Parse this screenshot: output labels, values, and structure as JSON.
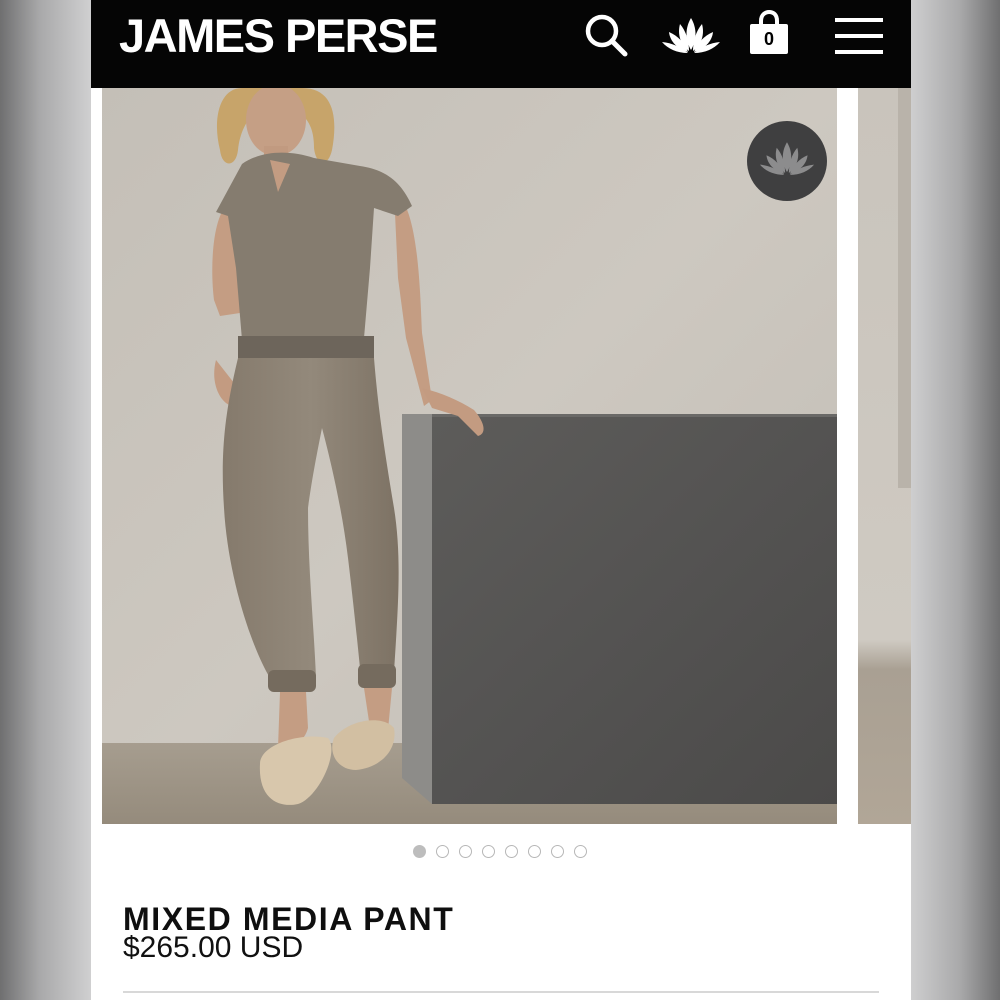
{
  "header": {
    "brand": "JAMES PERSE",
    "cart_count": "0",
    "icons": [
      "search-icon",
      "lotus-icon",
      "shopping-bag-icon",
      "hamburger-menu-icon"
    ]
  },
  "gallery": {
    "slide_count": 8,
    "active_index": 0,
    "badge_icon": "lotus-icon"
  },
  "product": {
    "name": "MIXED MEDIA PANT",
    "price": "$265.00 USD"
  },
  "colors": {
    "header_bg": "#050505",
    "badge_bg": "#3f3f40",
    "text": "#0f0f0f"
  }
}
